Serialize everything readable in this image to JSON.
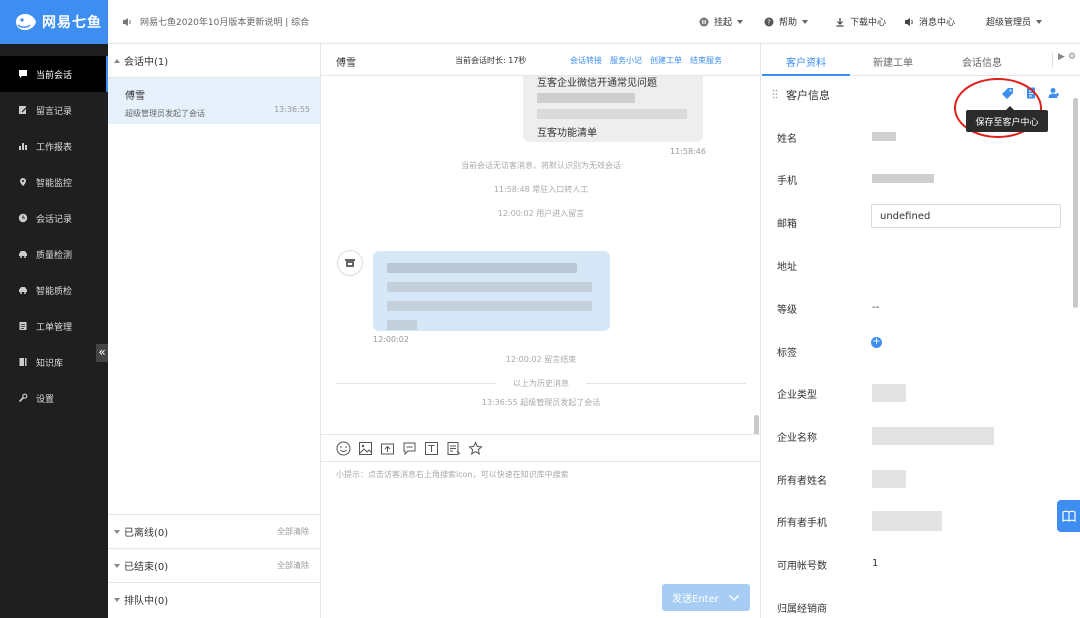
{
  "app": {
    "logo_text": "网易七鱼",
    "notice": "网易七鱼2020年10月版本更新说明 | 综合"
  },
  "top_actions": {
    "hangup": "挂起",
    "help": "帮助",
    "download": "下载中心",
    "messages": "消息中心",
    "user": "超级管理员"
  },
  "nav": {
    "items": [
      {
        "label": "当前会话",
        "icon": "chat-icon"
      },
      {
        "label": "留言记录",
        "icon": "edit-icon"
      },
      {
        "label": "工作报表",
        "icon": "bar-chart-icon"
      },
      {
        "label": "智能监控",
        "icon": "location-icon"
      },
      {
        "label": "会话记录",
        "icon": "clock-icon"
      },
      {
        "label": "质量检测",
        "icon": "car-icon"
      },
      {
        "label": "智能质检",
        "icon": "car-icon"
      },
      {
        "label": "工单管理",
        "icon": "document-icon"
      },
      {
        "label": "知识库",
        "icon": "book-icon"
      },
      {
        "label": "设置",
        "icon": "wrench-icon"
      }
    ],
    "collapse": "«"
  },
  "sessions": {
    "active_group": "会话中(1)",
    "item": {
      "name": "傅雪",
      "desc": "超级管理员发起了会话",
      "time": "13:36:55"
    },
    "offline": "已离线(0)",
    "ended": "已结束(0)",
    "queue": "排队中(0)",
    "clear_all": "全部清除"
  },
  "chat": {
    "title": "傅雪",
    "duration": "当前会话时长: 17秒",
    "actions": [
      "会话转接",
      "服务小记",
      "创建工单",
      "结束服务"
    ],
    "bubble_lines": [
      "互客企业微信开通常见问题",
      "互客功能清单"
    ],
    "bubble_time": "11:58:46",
    "sys_messages": [
      "当前会话无访客消息，将默认识别为无效会话",
      "11:58:48 常驻入口转人工",
      "12:00:02 用户进入留言"
    ],
    "customer_time": "12:00:02",
    "leave_end": "12:00:02 留言结束",
    "history": "以上为历史消息",
    "started": "13:36:55 超级管理员发起了会话",
    "hint": "小提示：点击访客消息右上角搜索icon，可以快速在知识库中搜索",
    "send": "发送Enter"
  },
  "right": {
    "tabs": [
      "客户资料",
      "新建工单",
      "会话信息"
    ],
    "info_title": "客户信息",
    "tooltip": "保存至客户中心",
    "fields": {
      "name": "姓名",
      "phone": "手机",
      "email": "邮箱",
      "email_value": "undefined",
      "address": "地址",
      "level": "等级",
      "level_value": "--",
      "tags": "标签",
      "company_type": "企业类型",
      "company_name": "企业名称",
      "owner_name": "所有者姓名",
      "owner_phone": "所有者手机",
      "accounts": "可用帐号数",
      "accounts_value": "1",
      "dealer": "归属经销商"
    }
  },
  "colors": {
    "brand": "#3d8ef0",
    "nav_bg": "#1f1f1f",
    "highlight": "#e0201b"
  }
}
